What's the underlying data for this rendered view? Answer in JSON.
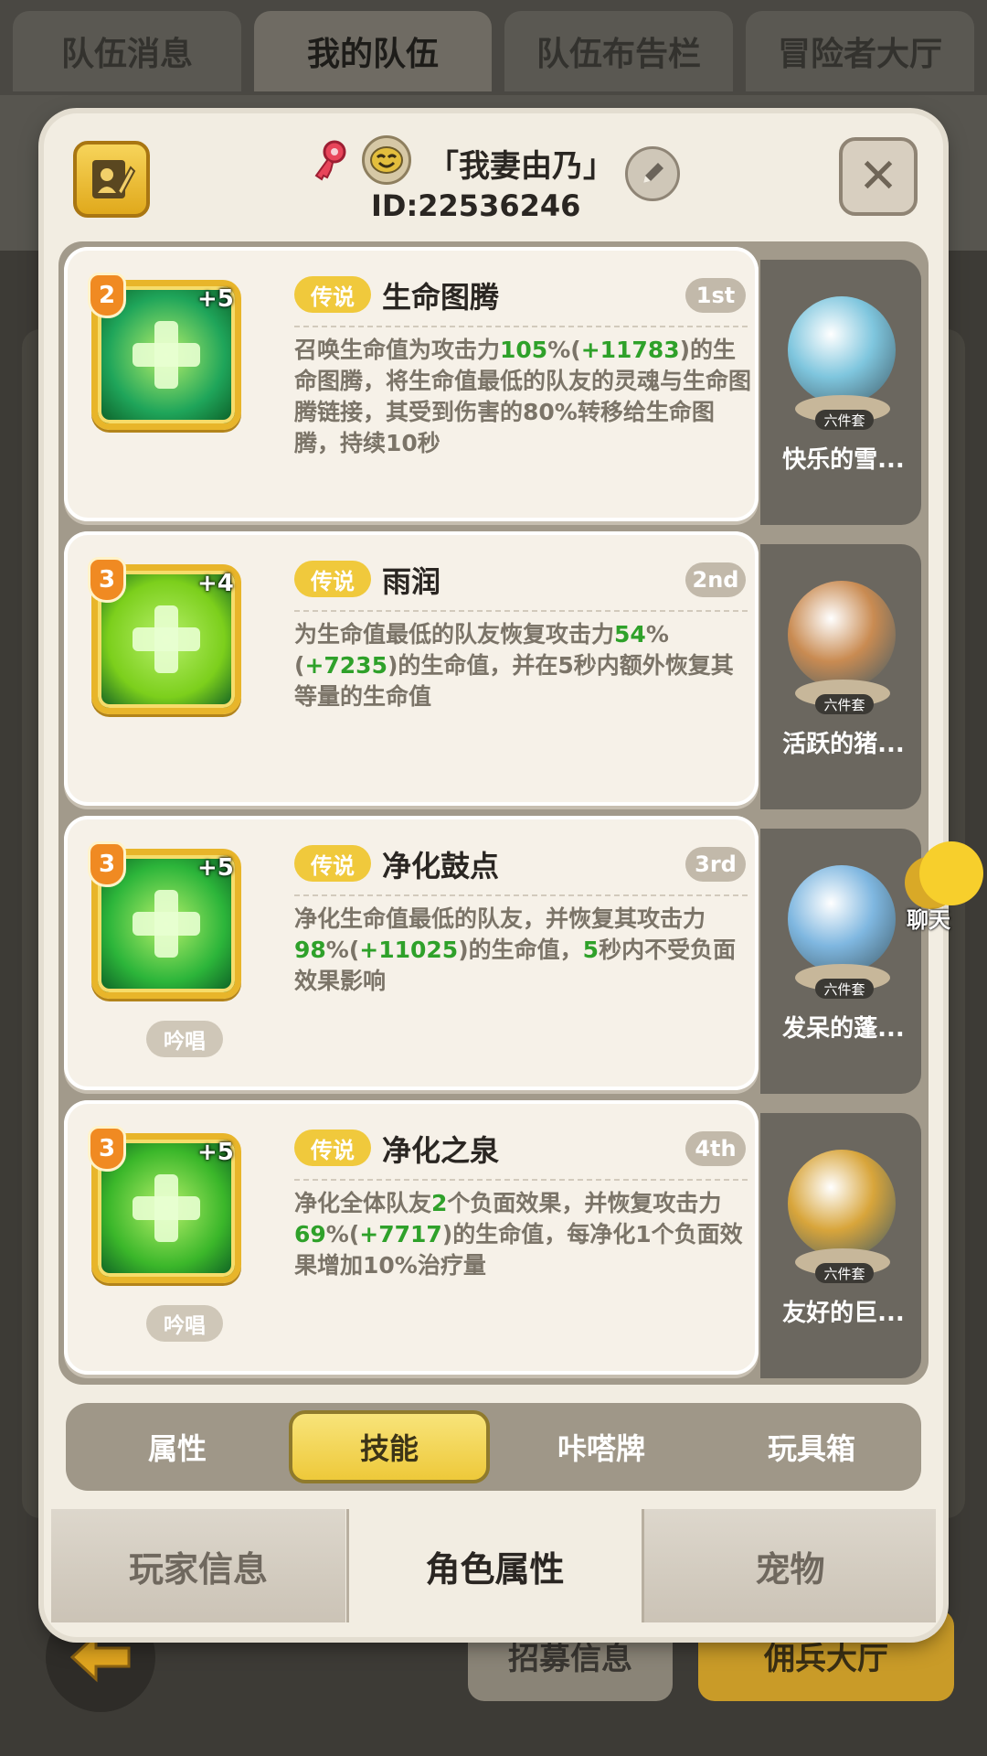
{
  "top_tabs": [
    "队伍消息",
    "我的队伍",
    "队伍布告栏",
    "冒险者大厅"
  ],
  "top_tab_active": 1,
  "header": {
    "name": "「我妻由乃」",
    "id": "ID:22536246"
  },
  "skills": [
    {
      "level": "2",
      "plus": "+5",
      "rarity": "传说",
      "name": "生命图腾",
      "rank": "1st",
      "desc": [
        "召唤生命值为攻击力",
        {
          "g": "105"
        },
        "%(",
        {
          "g": "+11783"
        },
        ")的生命图腾，将生命值最低的队友的灵魂与生命图腾链接，其受到伤害的80%转移给生命图腾，持续10秒"
      ],
      "chant": null,
      "hero": {
        "tag": "六件套",
        "name": "快乐的雪..."
      },
      "icon_color": "#1fa55a"
    },
    {
      "level": "3",
      "plus": "+4",
      "rarity": "传说",
      "name": "雨润",
      "rank": "2nd",
      "desc": [
        "为生命值最低的队友恢复攻击力",
        {
          "g": "54"
        },
        "%(",
        {
          "g": "+7235"
        },
        ")的生命值，并在5秒内额外恢复其等量的生命值"
      ],
      "chant": null,
      "hero": {
        "tag": "六件套",
        "name": "活跃的猪..."
      },
      "icon_color": "#7ccf1c"
    },
    {
      "level": "3",
      "plus": "+5",
      "rarity": "传说",
      "name": "净化鼓点",
      "rank": "3rd",
      "desc": [
        "净化生命值最低的队友，并恢复其攻击力",
        {
          "g": "98"
        },
        "%(",
        {
          "g": "+11025"
        },
        ")的生命值，",
        {
          "g": "5"
        },
        "秒内不受负面效果影响"
      ],
      "chant": "吟唱",
      "hero": {
        "tag": "六件套",
        "name": "发呆的蓬..."
      },
      "icon_color": "#2cb53a"
    },
    {
      "level": "3",
      "plus": "+5",
      "rarity": "传说",
      "name": "净化之泉",
      "rank": "4th",
      "desc": [
        "净化全体队友",
        {
          "g": "2"
        },
        "个负面效果，并恢复攻击力",
        {
          "g": "69"
        },
        "%(",
        {
          "g": "+7717"
        },
        ")的生命值，每净化1个负面效果增加10%治疗量"
      ],
      "chant": "吟唱",
      "hero": {
        "tag": "六件套",
        "name": "友好的巨..."
      },
      "icon_color": "#3bb72a"
    }
  ],
  "sub_tabs": [
    "属性",
    "技能",
    "咔嗒牌",
    "玩具箱"
  ],
  "sub_tab_active": 1,
  "bottom_tabs": [
    "玩家信息",
    "角色属性",
    "宠物"
  ],
  "bottom_tab_active": 1,
  "chat_label": "聊天",
  "background_buttons": {
    "recruit": "招募信息",
    "mercenary": "佣兵大厅"
  },
  "colors": {
    "accent_yellow": "#f0c93c",
    "highlight_green": "#2fa12a",
    "rank_grey": "#c2b9aa"
  }
}
